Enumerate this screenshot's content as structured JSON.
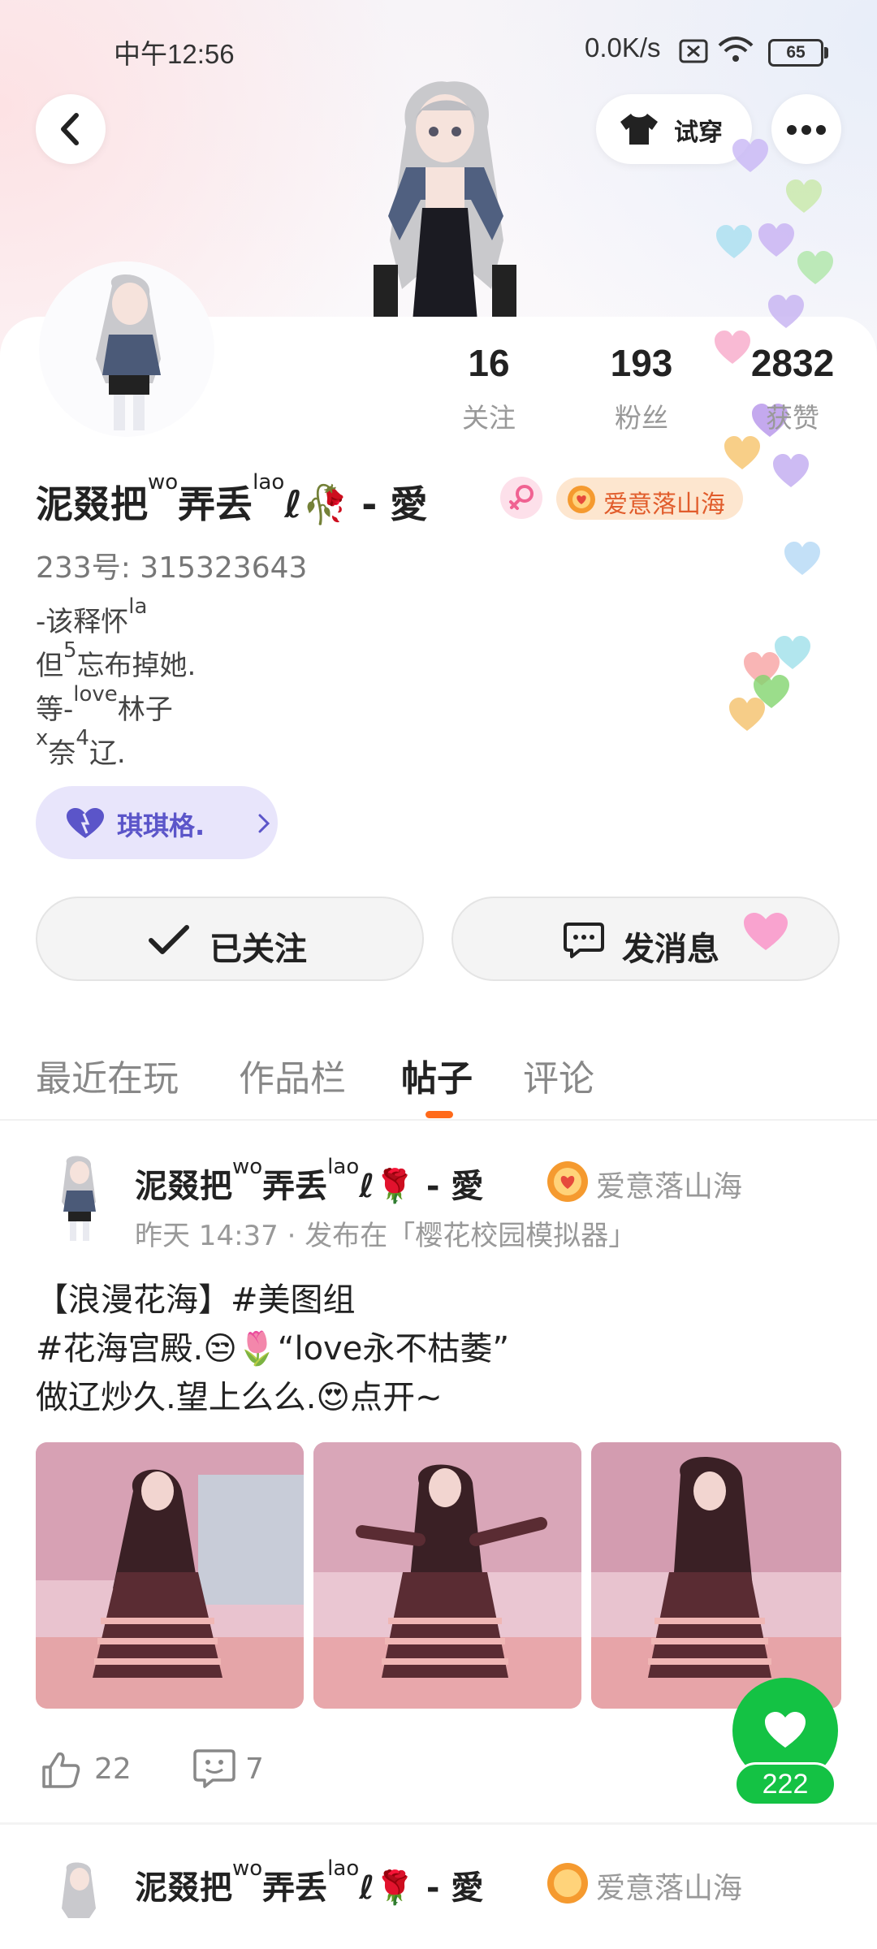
{
  "status_bar": {
    "time": "中午12:56",
    "net_speed": "0.0K/s",
    "battery": "65"
  },
  "header": {
    "back_icon": "back-arrow-icon",
    "tryon_label": "试穿",
    "more_icon": "more-dots-icon"
  },
  "profile": {
    "stats": [
      {
        "value": "16",
        "label": "关注"
      },
      {
        "value": "193",
        "label": "粉丝"
      },
      {
        "value": "2832",
        "label": "获赞"
      }
    ],
    "name_parts": [
      "泥叕把",
      "wo",
      "弄丢",
      "la",
      "o",
      "ℓ🥀 - 愛"
    ],
    "gender_icon": "female-symbol-icon",
    "badge_label": "爱意落山海",
    "uid": "233号: 315323643",
    "bio": [
      {
        "a": "-该释怀",
        "sup": "la",
        "b": ""
      },
      {
        "a": "但",
        "sup": "5",
        "b": "忘布掉她."
      },
      {
        "a": "等-",
        "sup": "love",
        "b": "林子"
      },
      {
        "a": "",
        "sup": "x",
        "b": "奈",
        "sup2": "4",
        "c": "辽."
      }
    ],
    "group_label": "琪琪格.",
    "follow_label": "已关注",
    "message_label": "发消息"
  },
  "tabs": [
    {
      "label": "最近在玩",
      "active": false
    },
    {
      "label": "作品栏",
      "active": false
    },
    {
      "label": "帖子",
      "active": true
    },
    {
      "label": "评论",
      "active": false
    }
  ],
  "post": {
    "author_parts": [
      "泥叕把",
      "wo",
      "弄丢",
      "la",
      "o",
      "ℓ🌹 - 愛"
    ],
    "badge_label": "爱意落山海",
    "meta": "昨天 14:37 · 发布在「樱花校园模拟器」",
    "lines": [
      "【浪漫花海】#美图组",
      "#花海宫殿.😒🌷“love永不枯萎”",
      "做辽炒久.望上么么.😍点开~"
    ],
    "likes": "22",
    "comments": "7"
  },
  "fab": {
    "count": "222"
  },
  "next_post": {
    "author_parts": [
      "泥叕把",
      "wo",
      "弄丢",
      "la",
      "o",
      "ℓ🌹 - 愛"
    ],
    "badge_label": "爱意落山海"
  },
  "colors": {
    "accent_orange": "#ff6a1a",
    "like_green": "#14c244",
    "badge_text": "#e15c2b",
    "group_purple": "#5b55c9"
  }
}
